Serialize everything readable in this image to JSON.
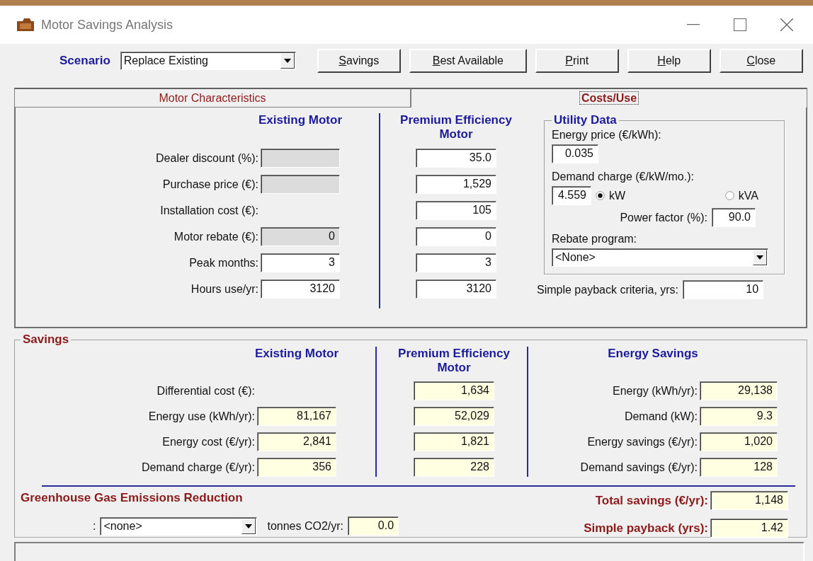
{
  "window": {
    "title": "Motor Savings Analysis"
  },
  "toolbar": {
    "scenario_label": "Scenario",
    "scenario": "Replace Existing",
    "buttons": [
      {
        "mnemonic": "S",
        "rest": "avings"
      },
      {
        "mnemonic": "B",
        "rest": "est Available"
      },
      {
        "mnemonic": "P",
        "rest": "rint"
      },
      {
        "mnemonic": "H",
        "rest": "elp"
      },
      {
        "mnemonic": "C",
        "rest": "lose"
      }
    ]
  },
  "tabs": [
    {
      "label": "Motor Characteristics",
      "selected": false
    },
    {
      "label": "Costs/Use",
      "selected": true
    }
  ],
  "characteristics": {
    "existing_heading": "Existing Motor",
    "premium_heading": "Premium Efficiency Motor",
    "rows": [
      {
        "label": "Dealer discount (%):",
        "existing": {
          "disabled": true
        },
        "premium": {
          "value": "35.0",
          "disabled": false
        }
      },
      {
        "label": "Purchase price (€):",
        "existing": {
          "disabled": true
        },
        "premium": {
          "value": "1,529",
          "disabled": false
        }
      },
      {
        "label": "Installation cost (€):",
        "premium": {
          "value": "105",
          "disabled": false
        }
      },
      {
        "label": "Motor rebate (€):",
        "existing": {
          "value": "0",
          "disabled": true
        },
        "premium": {
          "value": "0",
          "disabled": false
        }
      },
      {
        "label": "Peak months:",
        "existing": {
          "value": "3",
          "disabled": false
        },
        "premium": {
          "value": "3",
          "disabled": false
        }
      },
      {
        "label": "Hours use/yr:",
        "existing": {
          "value": "3120",
          "disabled": false
        },
        "premium": {
          "value": "3120",
          "disabled": false
        }
      }
    ]
  },
  "utility_data": {
    "title": "Utility Data",
    "energy_price_label": "Energy price (€/kWh):",
    "energy_price": "0.035",
    "demand_charge_label": "Demand charge (€/kW/mo.):",
    "demand_charge": "4.559",
    "units": [
      {
        "label": "kW",
        "selected": true
      },
      {
        "label": "kVA",
        "selected": false
      }
    ],
    "power_factor_label": "Power factor (%):",
    "power_factor": "90.0",
    "rebate_label": "Rebate program:",
    "rebate": "<None>"
  },
  "payback_criteria": {
    "label": "Simple payback criteria, yrs:",
    "value": "10"
  },
  "savings": {
    "title": "Savings",
    "existing_heading": "Existing Motor",
    "premium_heading": "Premium Efficiency Motor",
    "energy_heading": "Energy Savings",
    "rows": [
      {
        "label": "Differential cost (€):",
        "premium": "1,634"
      },
      {
        "label": "Energy use (kWh/yr):",
        "existing": "81,167",
        "premium": "52,029"
      },
      {
        "label": "Energy cost (€/yr):",
        "existing": "2,841",
        "premium": "1,821"
      },
      {
        "label": "Demand charge (€/yr):",
        "existing": "356",
        "premium": "228"
      }
    ],
    "energy_rows": [
      {
        "label": "Energy (kWh/yr):",
        "value": "29,138"
      },
      {
        "label": "Demand (kW):",
        "value": "9.3"
      },
      {
        "label": "Energy savings (€/yr):",
        "value": "1,020"
      },
      {
        "label": "Demand savings (€/yr):",
        "value": "128"
      }
    ],
    "ghg": {
      "title": "Greenhouse Gas Emissions Reduction",
      "prefix": ":",
      "select": "<none>",
      "tonnes_label": "tonnes CO2/yr:",
      "tonnes": "0.0"
    },
    "totals": [
      {
        "label": "Total savings (€/yr):",
        "value": "1,148"
      },
      {
        "label": "Simple payback (yrs):",
        "value": "1.42"
      }
    ]
  }
}
